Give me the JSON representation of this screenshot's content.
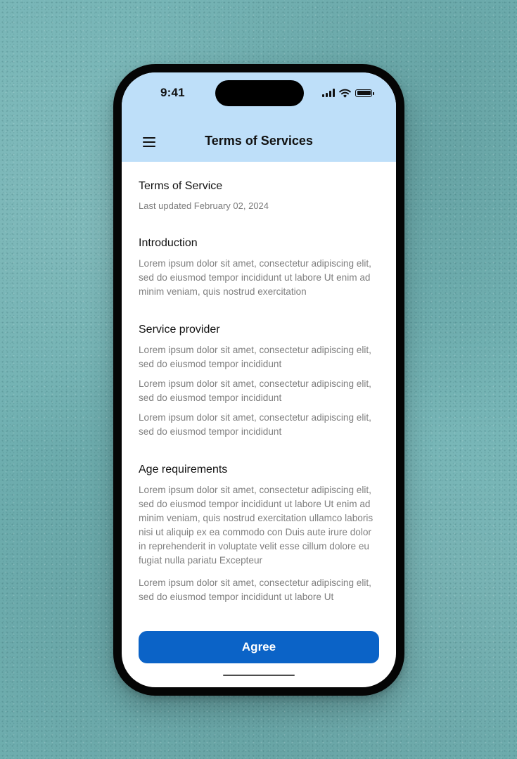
{
  "status_bar": {
    "time": "9:41",
    "icons": [
      "cellular-signal-icon",
      "wifi-icon",
      "battery-icon"
    ]
  },
  "header": {
    "menu_icon": "hamburger-menu-icon",
    "title": "Terms of Services"
  },
  "document": {
    "title": "Terms of Service",
    "last_updated": "Last updated February 02, 2024",
    "sections": [
      {
        "heading": "Introduction",
        "paragraphs": [
          "Lorem ipsum dolor sit amet, consectetur adipiscing elit, sed do eiusmod tempor incididunt ut labore Ut enim ad minim veniam, quis nostrud exercitation"
        ]
      },
      {
        "heading": "Service provider",
        "paragraphs": [
          "Lorem ipsum dolor sit amet, consectetur adipiscing elit, sed do eiusmod tempor incididunt",
          "Lorem ipsum dolor sit amet, consectetur adipiscing elit, sed do eiusmod tempor incididunt",
          "Lorem ipsum dolor sit amet, consectetur adipiscing elit, sed do eiusmod tempor incididunt"
        ]
      },
      {
        "heading": "Age requirements",
        "paragraphs": [
          "Lorem ipsum dolor sit amet, consectetur adipiscing elit, sed do eiusmod tempor incididunt ut labore Ut enim ad minim veniam, quis nostrud exercitation ullamco laboris nisi ut aliquip ex ea commodo con Duis aute irure dolor in reprehenderit in voluptate velit esse cillum dolore eu fugiat nulla pariatu Excepteur",
          "Lorem ipsum dolor sit amet, consectetur adipiscing elit, sed do eiusmod tempor incididunt ut labore Ut"
        ]
      }
    ]
  },
  "footer": {
    "agree_label": "Agree"
  },
  "colors": {
    "header_background": "#bedff9",
    "button_primary": "#0b63c7",
    "background_teal": "#73b4b5"
  }
}
